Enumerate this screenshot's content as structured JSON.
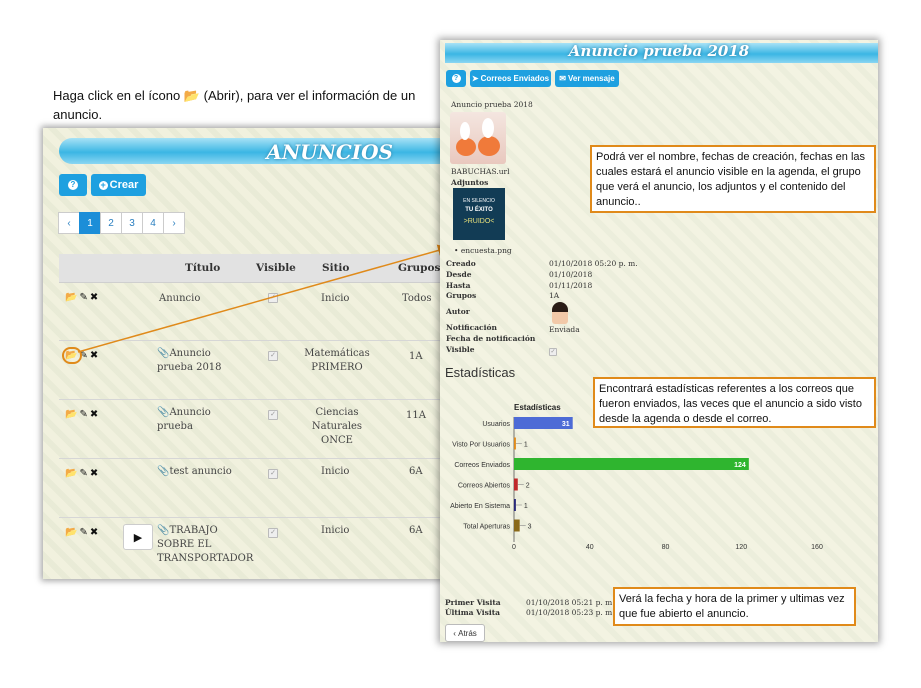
{
  "instruction": {
    "before": "Haga click en el ícono",
    "after": "(Abrir), para ver el información de un anuncio."
  },
  "left_panel": {
    "title": "ANUNCIOS",
    "help_label": "?",
    "create_label": "Crear",
    "pager": [
      "‹",
      "1",
      "2",
      "3",
      "4",
      "›"
    ],
    "pager_active": "1",
    "columns": [
      "Título",
      "Visible",
      "Sitio",
      "Grupos"
    ],
    "rows": [
      {
        "title": "Anuncio",
        "site": "Inicio",
        "groups": "Todos",
        "attachment": false,
        "play": false
      },
      {
        "title": "Anuncio prueba 2018",
        "site": "Matemáticas PRIMERO",
        "groups": "1A",
        "attachment": true,
        "play": false
      },
      {
        "title": "Anuncio prueba",
        "site": "Ciencias Naturales ONCE",
        "groups": "11A",
        "attachment": true,
        "play": false
      },
      {
        "title": "test anuncio",
        "site": "Inicio",
        "groups": "6A",
        "attachment": true,
        "play": false
      },
      {
        "title": "TRABAJO SOBRE EL TRANSPORTADOR",
        "site": "Inicio",
        "groups": "6A",
        "attachment": true,
        "play": true
      }
    ]
  },
  "right_panel": {
    "title": "Anuncio prueba 2018",
    "buttons": {
      "help": "?",
      "sent_mail": "Correos Enviados",
      "view_message": "Ver mensaje"
    },
    "name": "Anuncio prueba 2018",
    "url_file": "BABUCHAS.url",
    "attachments_label": "Adjuntos",
    "poster": {
      "line1": "EN SILENCIO",
      "line2": "TU ÉXITO",
      "line3": ">RUIDO<"
    },
    "attachment_file": "encuesta.png",
    "details": [
      {
        "label": "Creado",
        "value": "01/10/2018  05:20 p. m."
      },
      {
        "label": "Desde",
        "value": "01/10/2018"
      },
      {
        "label": "Hasta",
        "value": "01/11/2018"
      },
      {
        "label": "Grupos",
        "value": "1A"
      },
      {
        "label": "Autor",
        "value": ""
      },
      {
        "label": "Notificación",
        "value": "Enviada"
      },
      {
        "label": "Fecha de notificación",
        "value": ""
      },
      {
        "label": "Visible",
        "value": ""
      }
    ],
    "stats_heading": "Estadísticas",
    "visits": [
      {
        "label": "Primer Visita",
        "value": "01/10/2018 05:21 p. m."
      },
      {
        "label": "Última Visita",
        "value": "01/10/2018 05:23 p. m."
      }
    ],
    "back_label": "Atrás"
  },
  "callouts": {
    "details": "Podrá ver el nombre, fechas de creación, fechas en las cuales estará el anuncio visible en la agenda, el grupo que verá el anuncio, los adjuntos y el contenido del anuncio..",
    "stats": "Encontrará estadísticas referentes a los correos que fueron enviados, las veces que el anuncio a sido visto desde la agenda o desde el correo.",
    "visits": "Verá la fecha y hora de la primer y ultimas vez que fue abierto el anuncio."
  },
  "chart_data": {
    "type": "bar",
    "orientation": "horizontal",
    "title": "Estadísticas",
    "categories": [
      "Usuarios",
      "Visto Por Usuarios",
      "Correos Enviados",
      "Correos Abiertos",
      "Abierto En Sistema",
      "Total Aperturas"
    ],
    "values": [
      31,
      1,
      124,
      2,
      1,
      3
    ],
    "colors": [
      "#4d6bd6",
      "#e08a1a",
      "#2fb52f",
      "#c0282a",
      "#2a2a7a",
      "#8a6a1a"
    ],
    "xlim": [
      0,
      160
    ],
    "xticks": [
      0,
      40,
      80,
      120,
      160
    ],
    "grid": false,
    "legend": "none"
  },
  "colors": {
    "accent": "#1ea0e0",
    "callout_border": "#e08a1a",
    "banner": "#3bb6e4"
  }
}
